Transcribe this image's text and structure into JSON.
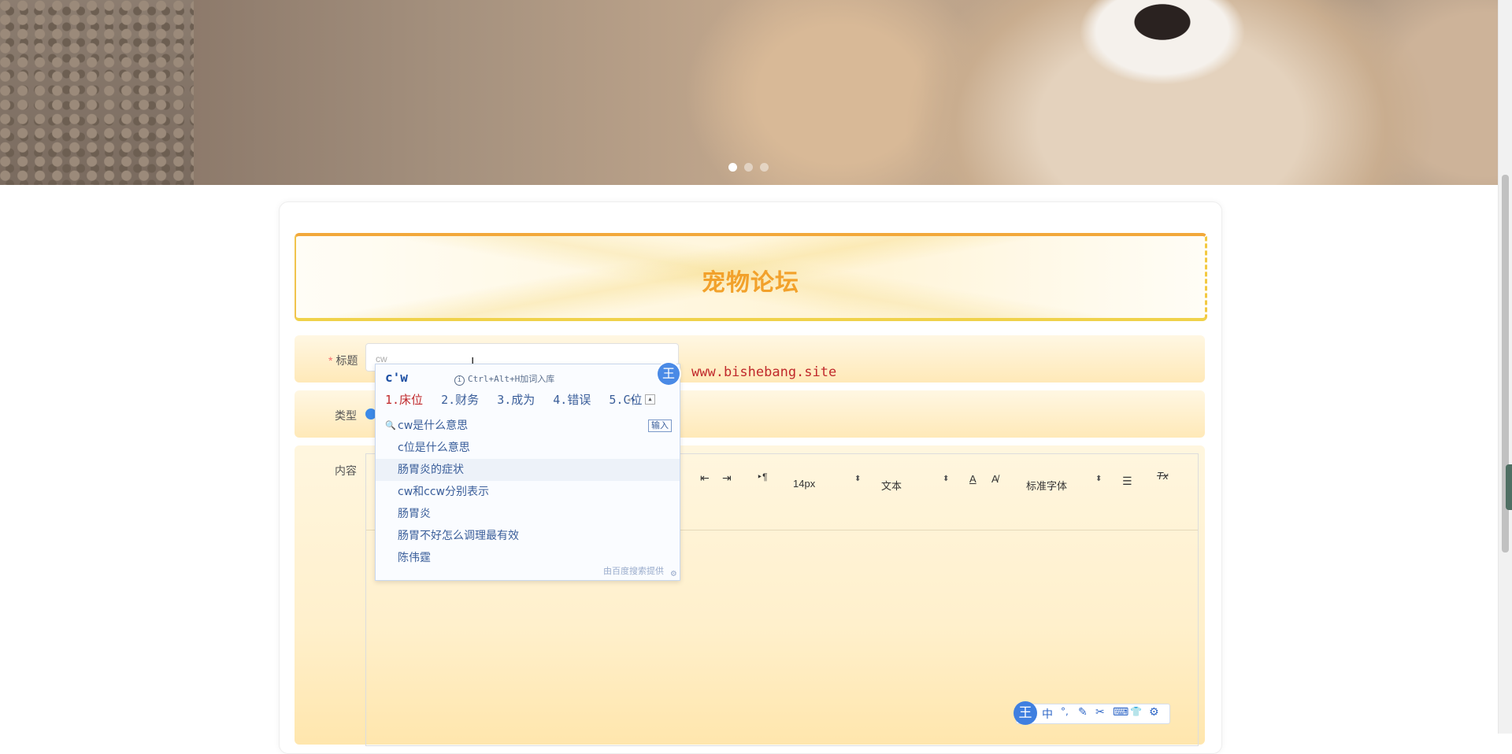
{
  "banner": {
    "slide_count": 3,
    "active_slide": 1
  },
  "form": {
    "heading": "宠物论坛",
    "title_label": "标题",
    "title_required_mark": "*",
    "title_value": "cw",
    "type_label": "类型",
    "content_label": "内容",
    "watermark": "www.bishebang.site"
  },
  "editor_toolbar": {
    "outdent_icon": "⇤",
    "indent_icon": "⇥",
    "paragraph_icon": "‣¶",
    "font_size": "14px",
    "block_format": "文本",
    "font_color_icon": "A",
    "bg_color_icon": "A̸",
    "font_family": "标准字体",
    "align_icon": "☰",
    "clear_format_icon": "Tx",
    "select_arrow": "⬍"
  },
  "ime_popup": {
    "composition": "c'w",
    "hint": "Ctrl+Alt+H加词入库",
    "candidates": [
      "1.床位",
      "2.财务",
      "3.成为",
      "4.错误",
      "5.C位"
    ],
    "suggestions": [
      "cw是什么意思",
      "c位是什么意思",
      "肠胃炎的症状",
      "cw和ccw分别表示",
      "肠胃炎",
      "肠胃不好怎么调理最有效",
      "陈伟霆"
    ],
    "enter_label": "输入",
    "footer": "由百度搜索提供",
    "badge": "王"
  },
  "ime_bar": {
    "logo": "王",
    "icons": [
      "中",
      "°,",
      "✎",
      "✂",
      "⌨",
      "👕",
      "⚙"
    ]
  },
  "colors": {
    "heading": "#f2a12b",
    "watermark": "#c0292b",
    "ime_text": "#3a5e9a",
    "ime_accent": "#4a8ae6"
  }
}
